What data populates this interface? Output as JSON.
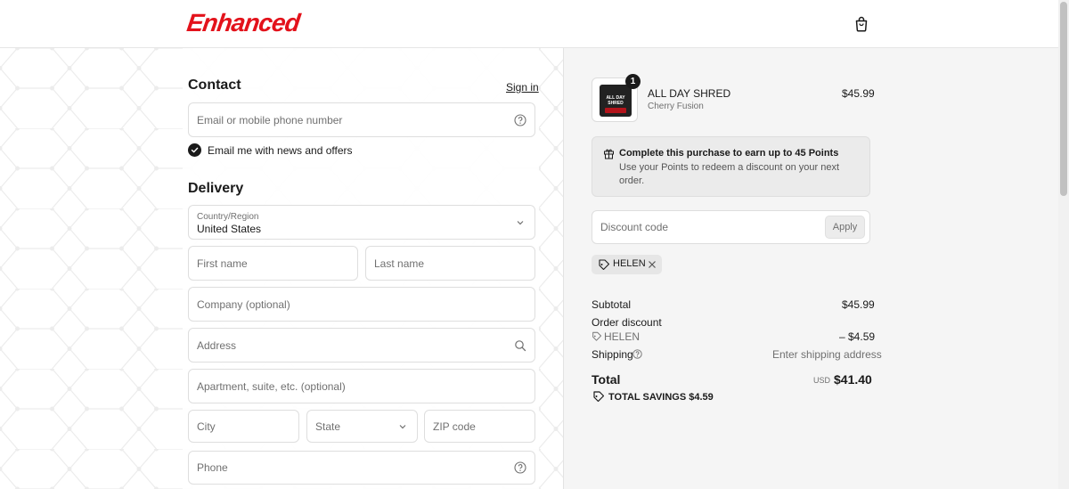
{
  "header": {
    "brand": "Enhanced",
    "cart_icon": "shopping-bag-icon"
  },
  "contact": {
    "heading": "Contact",
    "sign_in": "Sign in",
    "email_placeholder": "Email or mobile phone number",
    "newsletter_label": "Email me with news and offers",
    "newsletter_checked": true
  },
  "delivery": {
    "heading": "Delivery",
    "country_label": "Country/Region",
    "country_value": "United States",
    "first_name_placeholder": "First name",
    "last_name_placeholder": "Last name",
    "company_placeholder": "Company (optional)",
    "address_placeholder": "Address",
    "apartment_placeholder": "Apartment, suite, etc. (optional)",
    "city_placeholder": "City",
    "state_placeholder": "State",
    "zip_placeholder": "ZIP code",
    "phone_placeholder": "Phone"
  },
  "order": {
    "item": {
      "name": "ALL DAY SHRED",
      "variant": "Cherry Fusion",
      "price": "$45.99",
      "quantity": "1",
      "thumb_text": "ALL DAY SHRED"
    },
    "points": {
      "title": "Complete this purchase to earn up to 45 Points",
      "subtitle": "Use your Points to redeem a discount on your next order."
    },
    "discount": {
      "placeholder": "Discount code",
      "apply": "Apply",
      "applied_code": "HELEN"
    },
    "summary": {
      "subtotal_label": "Subtotal",
      "subtotal_value": "$45.99",
      "order_discount_label": "Order discount",
      "discount_code": "HELEN",
      "discount_value": "– $4.59",
      "shipping_label": "Shipping",
      "shipping_value": "Enter shipping address",
      "total_label": "Total",
      "currency": "USD",
      "total_value": "$41.40",
      "savings_label": "TOTAL SAVINGS $4.59"
    }
  },
  "colors": {
    "brand_red": "#e3121b",
    "summary_bg": "#f5f5f5",
    "text": "#1a1a1a",
    "muted": "#707070"
  }
}
